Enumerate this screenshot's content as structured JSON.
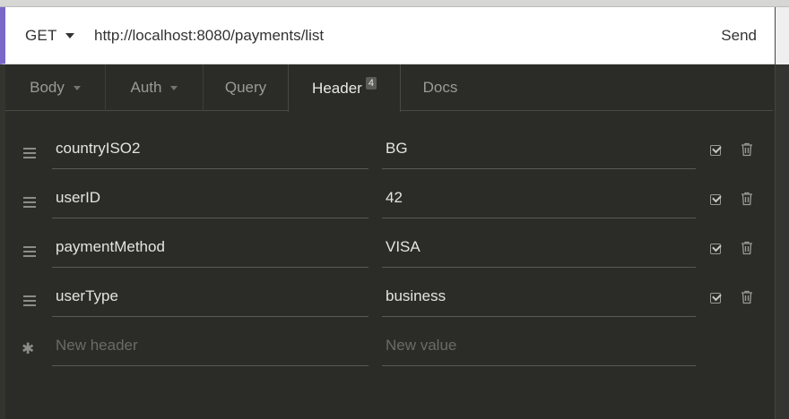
{
  "request": {
    "method": "GET",
    "url": "http://localhost:8080/payments/list",
    "send_label": "Send"
  },
  "tabs": [
    {
      "label": "Body",
      "dropdown": true
    },
    {
      "label": "Auth",
      "dropdown": true
    },
    {
      "label": "Query",
      "dropdown": false
    },
    {
      "label": "Header",
      "badge": "4",
      "active": true
    },
    {
      "label": "Docs",
      "dropdown": false
    }
  ],
  "headers": [
    {
      "name": "countryISO2",
      "value": "BG",
      "enabled": true
    },
    {
      "name": "userID",
      "value": "42",
      "enabled": true
    },
    {
      "name": "paymentMethod",
      "value": "VISA",
      "enabled": true
    },
    {
      "name": "userType",
      "value": "business",
      "enabled": true
    }
  ],
  "new_header": {
    "name_placeholder": "New header",
    "value_placeholder": "New value"
  },
  "icons": {
    "drag": "drag-handle-icon",
    "settings": "gear-icon",
    "enabled": "checkbox-icon",
    "delete": "trash-icon",
    "dropdown": "caret-down-icon"
  },
  "colors": {
    "accent": "#7b67c9",
    "panel_bg": "#2b2b27",
    "text": "#e4e4e0",
    "muted": "#9b9b95"
  }
}
